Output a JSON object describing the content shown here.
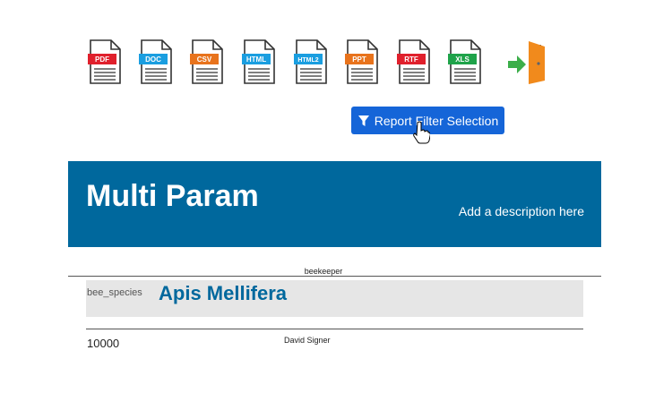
{
  "export_formats": [
    {
      "label": "PDF",
      "color": "#e0202c"
    },
    {
      "label": "DOC",
      "color": "#1a9ee0"
    },
    {
      "label": "CSV",
      "color": "#e8731c"
    },
    {
      "label": "HTML",
      "color": "#1a9ee0"
    },
    {
      "label": "HTML2",
      "color": "#1a9ee0"
    },
    {
      "label": "PPT",
      "color": "#e8731c"
    },
    {
      "label": "RTF",
      "color": "#e0202c"
    },
    {
      "label": "XLS",
      "color": "#1fa34a"
    }
  ],
  "exit_icon": "exit-door-icon",
  "filter_button": {
    "label": "Report Filter Selection",
    "icon": "filter-icon"
  },
  "banner": {
    "title": "Multi Param",
    "description": "Add a description here",
    "color": "#00689d"
  },
  "report": {
    "group_label": "beekeeper",
    "species_key": "bee_species",
    "species_value": "Apis Mellifera",
    "count": "10000",
    "person": "David Signer"
  },
  "accent": "#1565d8"
}
